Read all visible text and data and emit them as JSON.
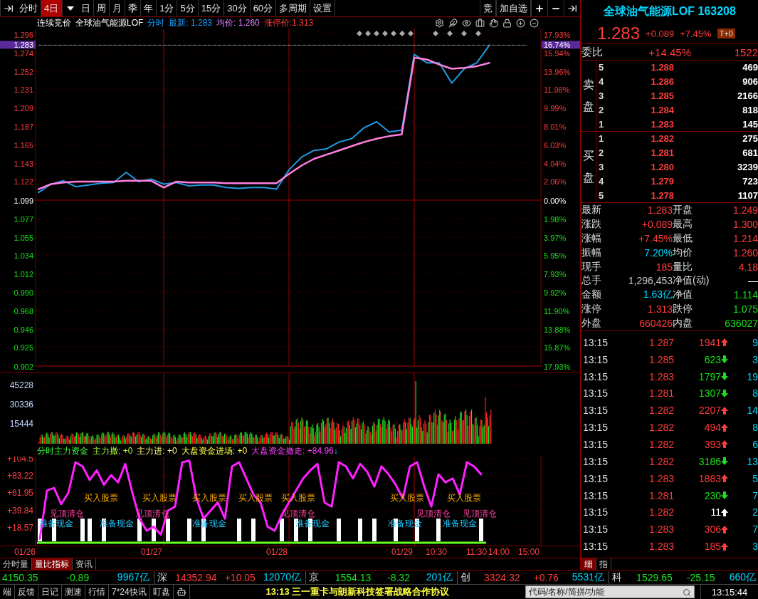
{
  "toolbar": {
    "items": [
      {
        "kind": "tab",
        "label": "分时",
        "selected": false
      },
      {
        "kind": "tab",
        "label": "4日",
        "selected": true
      },
      {
        "kind": "caret"
      },
      {
        "kind": "tab",
        "label": "日",
        "selected": false
      },
      {
        "kind": "tab",
        "label": "周",
        "selected": false
      },
      {
        "kind": "tab",
        "label": "月",
        "selected": false
      },
      {
        "kind": "tab",
        "label": "季",
        "selected": false
      },
      {
        "kind": "tab",
        "label": "年",
        "selected": false
      },
      {
        "kind": "tab",
        "label": "1分",
        "selected": false
      },
      {
        "kind": "tab",
        "label": "5分",
        "selected": false
      },
      {
        "kind": "tab",
        "label": "15分",
        "selected": false
      },
      {
        "kind": "tab",
        "label": "30分",
        "selected": false
      },
      {
        "kind": "tab",
        "label": "60分",
        "selected": false
      },
      {
        "kind": "tab",
        "label": "多周期",
        "selected": false
      },
      {
        "kind": "tab",
        "label": "设置",
        "selected": false
      }
    ],
    "right_buttons": [
      "竞",
      "加自选"
    ]
  },
  "chart_header": {
    "session": "连续竞价",
    "name": "全球油气能源LOF",
    "mode": "分时",
    "latest": "最新: 1.283",
    "average": "均价: 1.260",
    "limit_up": "涨停价:1.313"
  },
  "price_chart": {
    "chart_data": {
      "type": "line",
      "ylim": [
        0.902,
        1.296
      ],
      "yticks": [
        {
          "value": 1.296,
          "label": "1.296"
        },
        {
          "value": 1.274,
          "label": "1.274"
        },
        {
          "value": 1.252,
          "label": "1.252"
        },
        {
          "value": 1.231,
          "label": "1.231"
        },
        {
          "value": 1.209,
          "label": "1.209"
        },
        {
          "value": 1.187,
          "label": "1.187"
        },
        {
          "value": 1.165,
          "label": "1.165"
        },
        {
          "value": 1.143,
          "label": "1.143"
        },
        {
          "value": 1.122,
          "label": "1.122"
        },
        {
          "value": 1.099,
          "label": "1.099"
        },
        {
          "value": 1.077,
          "label": "1.077"
        },
        {
          "value": 1.055,
          "label": "1.055"
        },
        {
          "value": 1.034,
          "label": "1.034"
        },
        {
          "value": 1.012,
          "label": "1.012"
        },
        {
          "value": 0.99,
          "label": "0.990"
        },
        {
          "value": 0.968,
          "label": "0.968"
        },
        {
          "value": 0.946,
          "label": "0.946"
        },
        {
          "value": 0.925,
          "label": "0.925"
        },
        {
          "value": 0.902,
          "label": "0.902"
        }
      ],
      "series": [
        {
          "color": "#1e9be0",
          "values": [
            1.108,
            1.118,
            1.122,
            1.115,
            1.117,
            1.119,
            1.12,
            1.132,
            1.121,
            1.124,
            1.118,
            1.12,
            1.116,
            1.117,
            1.117,
            1.114,
            1.113,
            1.114,
            1.114,
            1.112,
            1.135,
            1.15,
            1.158,
            1.16,
            1.168,
            1.172,
            1.185,
            1.192,
            1.18,
            1.182,
            1.272,
            1.262,
            1.262,
            1.238,
            1.255,
            1.262,
            1.283,
            null,
            null,
            null
          ]
        },
        {
          "color": "#ff80e0",
          "values": [
            1.112,
            1.118,
            1.12,
            1.121,
            1.121,
            1.121,
            1.121,
            1.122,
            1.122,
            1.122,
            1.114,
            1.121,
            1.12,
            1.12,
            1.12,
            1.119,
            1.119,
            1.119,
            1.119,
            1.119,
            1.13,
            1.14,
            1.148,
            1.153,
            1.158,
            1.163,
            1.168,
            1.172,
            1.175,
            1.177,
            1.268,
            1.266,
            1.26,
            1.255,
            1.256,
            1.258,
            1.262,
            null,
            null,
            null
          ]
        },
        {
          "color": "#888888",
          "line_style": "dashed",
          "values": [
            1.283,
            1.283,
            1.283,
            1.283,
            1.283,
            1.283,
            1.283,
            1.283,
            1.283,
            1.283,
            1.283,
            1.283,
            1.283,
            1.283,
            1.283,
            1.283,
            1.283,
            1.283,
            1.283,
            1.283,
            1.283,
            1.283,
            1.283,
            1.283,
            1.283,
            1.283,
            1.283,
            1.283,
            1.283,
            1.283,
            1.283,
            1.283,
            1.283,
            1.283,
            1.283,
            1.283,
            1.283,
            1.283,
            1.283,
            1.283
          ]
        }
      ],
      "grid": true
    },
    "percent_ticks": [
      {
        "label": "17.93%",
        "kind": "up"
      },
      {
        "label": "15.94%",
        "kind": "up"
      },
      {
        "label": "13.96%",
        "kind": "up"
      },
      {
        "label": "11.98%",
        "kind": "up"
      },
      {
        "label": "9.99%",
        "kind": "up"
      },
      {
        "label": "8.01%",
        "kind": "up"
      },
      {
        "label": "6.03%",
        "kind": "up"
      },
      {
        "label": "4.04%",
        "kind": "up"
      },
      {
        "label": "2.06%",
        "kind": "up"
      },
      {
        "label": "0.00%",
        "kind": "flat"
      },
      {
        "label": "1.98%",
        "kind": "down"
      },
      {
        "label": "3.97%",
        "kind": "down"
      },
      {
        "label": "5.95%",
        "kind": "down"
      },
      {
        "label": "7.93%",
        "kind": "down"
      },
      {
        "label": "9.92%",
        "kind": "down"
      },
      {
        "label": "11.90%",
        "kind": "down"
      },
      {
        "label": "13.88%",
        "kind": "down"
      },
      {
        "label": "15.87%",
        "kind": "down"
      },
      {
        "label": "17.93%",
        "kind": "down"
      }
    ],
    "current_price": {
      "label": "1.283",
      "percent": "16.74%"
    }
  },
  "volume_chart": {
    "ticks": [
      "45228",
      "30336",
      "15444"
    ]
  },
  "indicator": {
    "readouts": [
      {
        "text": "分时主力资金",
        "kind": "title"
      },
      {
        "text": "主力撤: +0",
        "kind": "outflow"
      },
      {
        "text": "主力进: +0",
        "kind": "inflow"
      },
      {
        "text": "大盘资金进场: +0",
        "kind": "market_in"
      },
      {
        "text": "大盘资金撤走: +84.96",
        "kind": "market_out"
      },
      {
        "text": "↓",
        "kind": "arrow"
      }
    ],
    "chart_data": {
      "type": "line",
      "ylim": [
        0,
        104.5
      ],
      "grid": true,
      "yticks": [
        {
          "value": 104.5,
          "label": "+104.5"
        },
        {
          "value": 83.22,
          "label": "+83.22"
        },
        {
          "value": 61.95,
          "label": "+61.95"
        },
        {
          "value": 39.84,
          "label": "+39.84"
        },
        {
          "value": 18.57,
          "label": "+18.57"
        }
      ],
      "series": [
        {
          "color": "#ffffff",
          "type": "bar",
          "values": [
            30,
            null,
            30,
            null,
            null,
            null,
            30,
            30,
            null,
            30,
            null,
            null,
            null,
            null,
            30,
            null,
            30,
            null,
            30,
            null,
            null,
            30,
            null,
            30,
            null,
            null,
            null,
            null,
            30,
            null,
            30,
            null,
            null,
            null,
            30,
            null,
            30,
            null,
            30,
            null,
            null,
            null,
            30,
            null,
            null,
            30,
            null,
            30,
            null,
            null,
            30,
            null,
            null,
            30,
            null,
            null,
            30,
            null,
            null,
            null,
            null,
            null,
            30
          ]
        },
        {
          "color": "#ff20ff",
          "values": [
            5,
            65,
            68,
            48,
            62,
            100,
            95,
            78,
            90,
            72,
            84,
            75,
            98,
            62,
            30,
            15,
            20,
            10,
            40,
            45,
            100,
            102,
            55,
            30,
            40,
            50,
            30,
            95,
            100,
            80,
            60,
            50,
            20,
            15,
            35,
            50,
            65,
            80,
            90,
            98,
            50,
            45,
            100,
            95,
            80,
            98,
            88,
            70,
            95,
            85,
            72,
            55,
            95,
            100,
            70,
            45,
            85,
            75,
            80,
            60,
            100,
            95,
            85
          ]
        }
      ]
    },
    "signals": [
      {
        "kind": "buy",
        "text": "买入股票"
      },
      {
        "kind": "buy",
        "text": "买入股票"
      },
      {
        "kind": "buy",
        "text": "买入股票"
      },
      {
        "kind": "buy",
        "text": "买入股票"
      },
      {
        "kind": "buy",
        "text": "买入股票"
      },
      {
        "kind": "buy",
        "text": "买入股票"
      },
      {
        "kind": "buy",
        "text": "买入股票"
      },
      {
        "kind": "top",
        "text": "见顶清仓"
      },
      {
        "kind": "top",
        "text": "见顶清仓"
      },
      {
        "kind": "top",
        "text": "见顶清仓"
      },
      {
        "kind": "top",
        "text": "见顶清仓"
      },
      {
        "kind": "top",
        "text": "见顶清仓"
      },
      {
        "kind": "cash",
        "text": "准备现金"
      },
      {
        "kind": "cash",
        "text": "准备现金"
      },
      {
        "kind": "cash",
        "text": "准备现金"
      },
      {
        "kind": "cash",
        "text": "准备现金"
      },
      {
        "kind": "cash",
        "text": "准备现金"
      },
      {
        "kind": "cash",
        "text": "准备现金"
      }
    ]
  },
  "x_axis": [
    "01/26",
    "01/27",
    "01/28",
    "01/29",
    "10:30",
    "11:30",
    "14:00",
    "15:00"
  ],
  "bottom_tabs": [
    {
      "label": "分时量",
      "selected": false
    },
    {
      "label": "量比指标",
      "selected": true
    },
    {
      "label": "资讯",
      "selected": false
    }
  ],
  "quote": {
    "title": "全球油气能源LOF 163208",
    "price": "1.283",
    "change": "+0.089",
    "change_pct": "+7.45%",
    "badge": "T+0",
    "ratio": {
      "label": "委比",
      "value": "+14.45%",
      "volume": "1522"
    },
    "sell": {
      "label": "卖盘",
      "levels": [
        {
          "level": "5",
          "price": "1.288",
          "volume": "469"
        },
        {
          "level": "4",
          "price": "1.286",
          "volume": "906"
        },
        {
          "level": "3",
          "price": "1.285",
          "volume": "2166"
        },
        {
          "level": "2",
          "price": "1.284",
          "volume": "818"
        },
        {
          "level": "1",
          "price": "1.283",
          "volume": "145"
        }
      ]
    },
    "buy": {
      "label": "买盘",
      "levels": [
        {
          "level": "1",
          "price": "1.282",
          "volume": "275"
        },
        {
          "level": "2",
          "price": "1.281",
          "volume": "681"
        },
        {
          "level": "3",
          "price": "1.280",
          "volume": "3239"
        },
        {
          "level": "4",
          "price": "1.279",
          "volume": "723"
        },
        {
          "level": "5",
          "price": "1.278",
          "volume": "1107"
        }
      ]
    },
    "stats": [
      {
        "left": {
          "label": "最新",
          "value": "1.283",
          "kind": "up"
        },
        "right": {
          "label": "开盘",
          "value": "1.249",
          "kind": "up"
        }
      },
      {
        "left": {
          "label": "涨跌",
          "value": "+0.089",
          "kind": "up"
        },
        "right": {
          "label": "最高",
          "value": "1.300",
          "kind": "up"
        }
      },
      {
        "left": {
          "label": "涨幅",
          "value": "+7.45%",
          "kind": "up"
        },
        "right": {
          "label": "最低",
          "value": "1.214",
          "kind": "up"
        }
      },
      {
        "left": {
          "label": "振幅",
          "value": "7.20%",
          "kind": "info"
        },
        "right": {
          "label": "均价",
          "value": "1.260",
          "kind": "up"
        }
      },
      {
        "left": {
          "label": "现手",
          "value": "185",
          "kind": "up"
        },
        "right": {
          "label": "量比",
          "value": "4.18",
          "kind": "up"
        }
      },
      {
        "left": {
          "label": "总手",
          "value": "1,296,453",
          "kind": "plain"
        },
        "right": {
          "label": "净值(动)",
          "value": "—",
          "kind": "flat"
        }
      },
      {
        "left": {
          "label": "金额",
          "value": "1.63亿",
          "kind": "info"
        },
        "right": {
          "label": "净值",
          "value": "1.114",
          "kind": "down"
        }
      },
      {
        "left": {
          "label": "涨停",
          "value": "1.313",
          "kind": "up"
        },
        "right": {
          "label": "跌停",
          "value": "1.075",
          "kind": "down"
        }
      },
      {
        "left": {
          "label": "外盘",
          "value": "660426",
          "kind": "up"
        },
        "right": {
          "label": "内盘",
          "value": "636027",
          "kind": "down"
        }
      }
    ],
    "trades": [
      {
        "time": "13:15",
        "price": "1.287",
        "volume": "1941",
        "kind": "up",
        "column_4": "9"
      },
      {
        "time": "13:15",
        "price": "1.285",
        "volume": "623",
        "kind": "down",
        "column_4": "3"
      },
      {
        "time": "13:15",
        "price": "1.283",
        "volume": "1797",
        "kind": "down",
        "column_4": "19"
      },
      {
        "time": "13:15",
        "price": "1.281",
        "volume": "1307",
        "kind": "down",
        "column_4": "8"
      },
      {
        "time": "13:15",
        "price": "1.282",
        "volume": "2207",
        "kind": "up",
        "column_4": "14"
      },
      {
        "time": "13:15",
        "price": "1.282",
        "volume": "494",
        "kind": "up",
        "column_4": "8"
      },
      {
        "time": "13:15",
        "price": "1.282",
        "volume": "393",
        "kind": "up",
        "column_4": "6"
      },
      {
        "time": "13:15",
        "price": "1.282",
        "volume": "3186",
        "kind": "down",
        "column_4": "13"
      },
      {
        "time": "13:15",
        "price": "1.283",
        "volume": "1883",
        "kind": "up",
        "column_4": "5"
      },
      {
        "time": "13:15",
        "price": "1.281",
        "volume": "230",
        "kind": "down",
        "column_4": "7"
      },
      {
        "time": "13:15",
        "price": "1.282",
        "volume": "11",
        "kind": "neutral",
        "column_4": "2"
      },
      {
        "time": "13:15",
        "price": "1.283",
        "volume": "306",
        "kind": "up",
        "column_4": "7"
      },
      {
        "time": "13:15",
        "price": "1.283",
        "volume": "185",
        "kind": "up",
        "column_4": "3"
      }
    ],
    "tabs": [
      {
        "label": "细",
        "selected": true
      },
      {
        "label": "指",
        "selected": false
      }
    ]
  },
  "index_bar": [
    {
      "value": "4150.35",
      "change": "-0.89",
      "amount": "9967亿",
      "kind": "down"
    },
    {
      "label": "深",
      "value": "14352.94",
      "change": "+10.05",
      "amount": "12070亿",
      "kind": "up"
    },
    {
      "label": "京",
      "value": "1554.13",
      "change": "-8.32",
      "amount": "201亿",
      "kind": "down"
    },
    {
      "label": "创",
      "value": "3324.32",
      "change": "+0.76",
      "amount": "5531亿",
      "kind": "up"
    },
    {
      "label": "科",
      "value": "1529.65",
      "change": "-25.15",
      "amount": "660亿",
      "kind": "down"
    }
  ],
  "status_bar": {
    "links": [
      "端",
      "反馈",
      "日记",
      "测速",
      "行情",
      "7*24快讯",
      "盯盘"
    ],
    "news": "13:13 三一重卡与朗新科技签署战略合作协议",
    "search": {
      "placeholder": "代码/名称/简拼/功能"
    },
    "time": "13:15:44"
  }
}
